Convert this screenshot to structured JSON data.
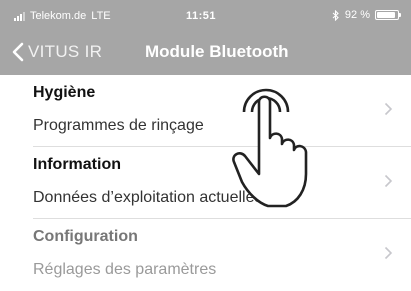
{
  "status_bar": {
    "carrier": "Telekom.de",
    "network": "LTE",
    "time": "11:51",
    "battery": "92 %",
    "battery_level": 0.92
  },
  "nav": {
    "back_label": "VITUS IR",
    "title": "Module Bluetooth"
  },
  "menu": [
    {
      "heading": "Hygiène",
      "subtitle": "Programmes de rinçage"
    },
    {
      "heading": "Information",
      "subtitle": "Données d’exploitation actuelles"
    },
    {
      "heading": "Configuration",
      "subtitle": "Réglages des paramètres"
    }
  ],
  "colors": {
    "header_bg": "#a6a6a6",
    "chevron": "#c7c7cc"
  },
  "icons": {
    "back": "chevron-left-icon",
    "row_arrow": "chevron-right-icon",
    "bluetooth": "bluetooth-icon",
    "tap_hint": "pointing-hand-icon"
  }
}
